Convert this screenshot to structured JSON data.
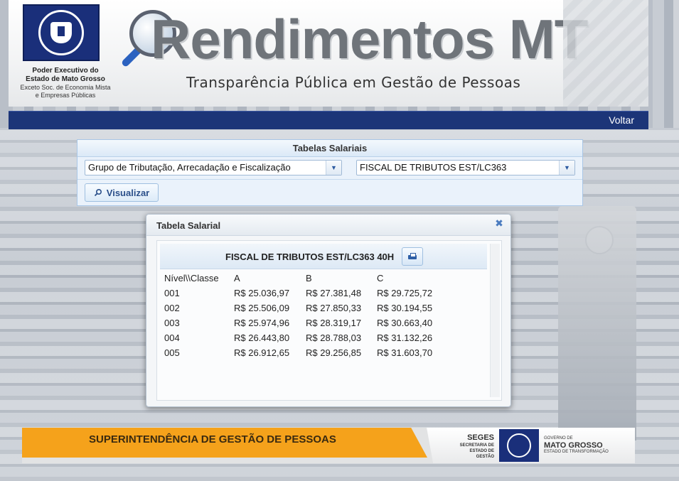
{
  "header": {
    "brand_title": "Rendimentos MT",
    "tagline": "Transparência Pública em Gestão de Pessoas",
    "gov_line1": "Poder Executivo do",
    "gov_line2": "Estado de Mato Grosso",
    "gov_line3": "Exceto Soc. de Economia Mista",
    "gov_line4": "e Empresas Públicas"
  },
  "nav": {
    "voltar": "Voltar"
  },
  "filters": {
    "title": "Tabelas Salariais",
    "group_selected": "Grupo de Tributação, Arrecadação e Fiscalização",
    "cargo_selected": "FISCAL DE TRIBUTOS EST/LC363",
    "visualizar_label": "Visualizar"
  },
  "dialog": {
    "title": "Tabela Salarial",
    "table_title": "FISCAL DE TRIBUTOS EST/LC363 40H",
    "columns": [
      "Nível\\\\Classe",
      "A",
      "B",
      "C"
    ],
    "rows": [
      [
        "001",
        "R$ 25.036,97",
        "R$ 27.381,48",
        "R$ 29.725,72"
      ],
      [
        "002",
        "R$ 25.506,09",
        "R$ 27.850,33",
        "R$ 30.194,55"
      ],
      [
        "003",
        "R$ 25.974,96",
        "R$ 28.319,17",
        "R$ 30.663,40"
      ],
      [
        "004",
        "R$ 26.443,80",
        "R$ 28.788,03",
        "R$ 31.132,26"
      ],
      [
        "005",
        "R$ 26.912,65",
        "R$ 29.256,85",
        "R$ 31.603,70"
      ]
    ]
  },
  "footer": {
    "superintendencia": "SUPERINTENDÊNCIA DE GESTÃO DE PESSOAS",
    "seges": "SEGES",
    "seges_sub1": "SECRETARIA DE",
    "seges_sub2": "ESTADO DE GESTÃO",
    "gov_label": "GOVERNO DE",
    "gov_name": "MATO GROSSO",
    "gov_sub": "ESTADO DE TRANSFORMAÇÃO"
  },
  "icons": {
    "close": "close-icon",
    "search": "search-icon",
    "print": "print-icon",
    "dropdown": "chevron-down-icon"
  },
  "colors": {
    "navbar": "#1c3578",
    "footer_orange": "#f5a21b",
    "panel_bg": "#eaf2fb",
    "accent_blue": "#2a4f8a"
  }
}
